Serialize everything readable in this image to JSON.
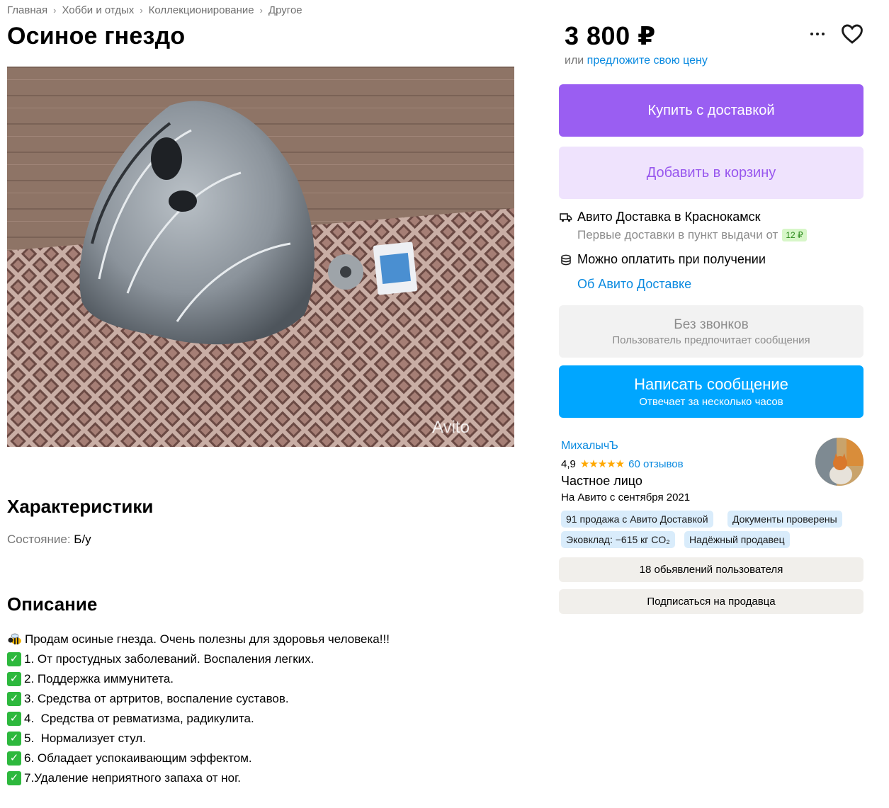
{
  "breadcrumbs": [
    "Главная",
    "Хобби и отдых",
    "Коллекционирование",
    "Другое"
  ],
  "listing": {
    "title": "Осиное гнездо",
    "photo_watermark": "Avito"
  },
  "characteristics": {
    "heading": "Характеристики",
    "condition_label": "Состояние:",
    "condition_value": "Б/у"
  },
  "description": {
    "heading": "Описание",
    "lines": [
      {
        "icon": "bee-icon",
        "text": "Продам осиные гнезда. Очень полезны для здоровья человека!!!"
      },
      {
        "icon": "check-icon",
        "text": "1. От простудных заболеваний. Воспаления легких."
      },
      {
        "icon": "check-icon",
        "text": "2. Поддержка иммунитета."
      },
      {
        "icon": "check-icon",
        "text": "3. Средства от артритов, воспаление суставов."
      },
      {
        "icon": "check-icon",
        "text": "4.  Средства от ревматизма, радикулита."
      },
      {
        "icon": "check-icon",
        "text": "5.  Нормализует стул."
      },
      {
        "icon": "check-icon",
        "text": "6. Обладает успокаивающим эффектом."
      },
      {
        "icon": "check-icon",
        "text": "7.Удаление неприятного запаха от ног."
      }
    ]
  },
  "sidebar": {
    "price": "3 800 ₽",
    "offer_prefix": "или",
    "offer_link": "предложите свою цену",
    "buy_button": "Купить с доставкой",
    "cart_button": "Добавить в корзину",
    "delivery_title": "Авито Доставка в Краснокамск",
    "delivery_sub": "Первые доставки в пункт выдачи от",
    "delivery_price": "12 ₽",
    "payment_text": "Можно оплатить при получении",
    "delivery_link": "Об Авито Доставке",
    "no_calls_title": "Без звонков",
    "no_calls_sub": "Пользователь предпочитает сообщения",
    "message_button": "Написать сообщение",
    "message_sub": "Отвечает за несколько часов"
  },
  "seller": {
    "name": "МихалычЪ",
    "rating": "4,9",
    "stars": "★★★★★",
    "reviews": "60 отзывов",
    "type": "Частное лицо",
    "since": "На Авито с сентября 2021",
    "badges": [
      "91 продажа с Авито Доставкой",
      "Документы проверены",
      "Эковклад: −615 кг CO₂",
      "Надёжный продавец"
    ],
    "listings_button": "18 обьявлений пользователя",
    "subscribe_button": "Подписаться на продавца"
  },
  "colors": {
    "buy": "#9a5ef2",
    "cart_bg": "#efe3fd",
    "message": "#00a6ff",
    "link": "#0a8ae0",
    "badge_bg": "#d9ecfb"
  }
}
